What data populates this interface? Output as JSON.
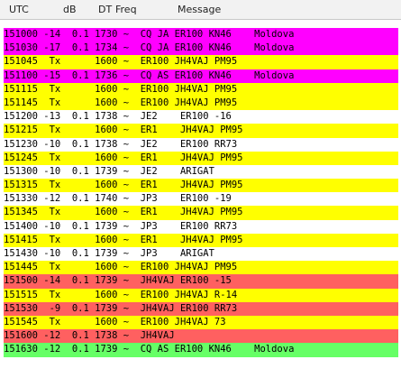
{
  "header": {
    "utc": "UTC",
    "db": "dB",
    "dt": "DT",
    "freq": "Freq",
    "message": "Message"
  },
  "colors": {
    "magenta": "#ff00ff",
    "yellow": "#ffff00",
    "white": "#ffffff",
    "red": "#ff6060",
    "green": "#66ff66"
  },
  "rows": [
    {
      "text": "151000 -14  0.1 1730 ~  CQ JA ER100 KN46    Moldova",
      "bg": "magenta"
    },
    {
      "text": "151030 -17  0.1 1734 ~  CQ JA ER100 KN46    Moldova",
      "bg": "magenta"
    },
    {
      "text": "151045  Tx      1600 ~  ER100 JH4VAJ PM95",
      "bg": "yellow"
    },
    {
      "text": "151100 -15  0.1 1736 ~  CQ AS ER100 KN46    Moldova",
      "bg": "magenta"
    },
    {
      "text": "151115  Tx      1600 ~  ER100 JH4VAJ PM95",
      "bg": "yellow"
    },
    {
      "text": "151145  Tx      1600 ~  ER100 JH4VAJ PM95",
      "bg": "yellow"
    },
    {
      "text": "151200 -13  0.1 1738 ~  JE2    ER100 -16",
      "bg": "white"
    },
    {
      "text": "151215  Tx      1600 ~  ER1    JH4VAJ PM95",
      "bg": "yellow"
    },
    {
      "text": "151230 -10  0.1 1738 ~  JE2    ER100 RR73",
      "bg": "white"
    },
    {
      "text": "151245  Tx      1600 ~  ER1    JH4VAJ PM95",
      "bg": "yellow"
    },
    {
      "text": "151300 -10  0.1 1739 ~  JE2    ARIGAT",
      "bg": "white"
    },
    {
      "text": "151315  Tx      1600 ~  ER1    JH4VAJ PM95",
      "bg": "yellow"
    },
    {
      "text": "151330 -12  0.1 1740 ~  JP3    ER100 -19",
      "bg": "white"
    },
    {
      "text": "151345  Tx      1600 ~  ER1    JH4VAJ PM95",
      "bg": "yellow"
    },
    {
      "text": "151400 -10  0.1 1739 ~  JP3    ER100 RR73",
      "bg": "white"
    },
    {
      "text": "151415  Tx      1600 ~  ER1    JH4VAJ PM95",
      "bg": "yellow"
    },
    {
      "text": "151430 -10  0.1 1739 ~  JP3    ARIGAT",
      "bg": "white"
    },
    {
      "text": "151445  Tx      1600 ~  ER100 JH4VAJ PM95",
      "bg": "yellow"
    },
    {
      "text": "151500 -14  0.1 1739 ~  JH4VAJ ER100 -15",
      "bg": "red"
    },
    {
      "text": "151515  Tx      1600 ~  ER100 JH4VAJ R-14",
      "bg": "yellow"
    },
    {
      "text": "151530  -9  0.1 1739 ~  JH4VAJ ER100 RR73",
      "bg": "red"
    },
    {
      "text": "151545  Tx      1600 ~  ER100 JH4VAJ 73",
      "bg": "yellow"
    },
    {
      "text": "151600 -12  0.1 1738 ~  JH4VAJ",
      "bg": "red"
    },
    {
      "text": "151630 -12  0.1 1739 ~  CQ AS ER100 KN46    Moldova",
      "bg": "green"
    }
  ]
}
